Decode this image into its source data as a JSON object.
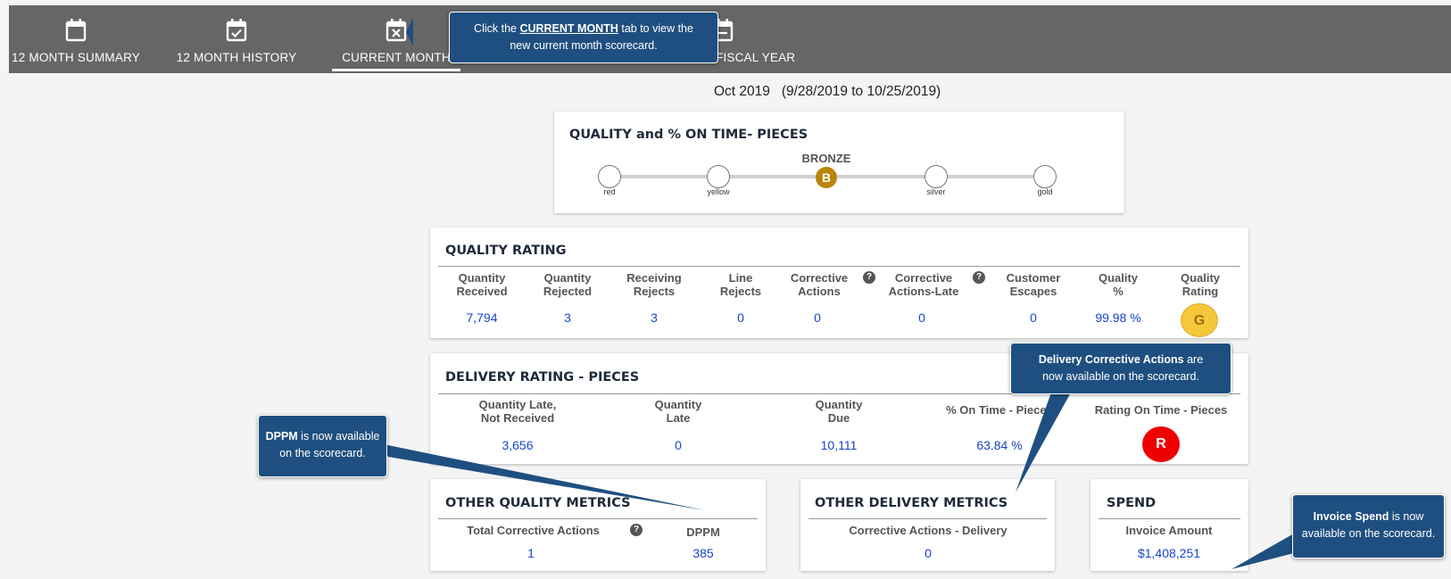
{
  "tabs": [
    {
      "label": "12 MONTH SUMMARY",
      "icon": "calendar-icon"
    },
    {
      "label": "12 MONTH HISTORY",
      "icon": "calendar-check-icon"
    },
    {
      "label": "CURRENT MONTH",
      "icon": "calendar-x-icon",
      "active": true
    },
    {
      "label": "FISCAL YEAR",
      "icon": "calendar-minus-icon"
    }
  ],
  "period": {
    "label": "Oct 2019",
    "range": "(9/28/2019 to 10/25/2019)"
  },
  "quality_time": {
    "title": "QUALITY and % ON TIME- PIECES",
    "current_level": "BRONZE",
    "current_letter": "B",
    "levels": [
      "red",
      "yellow",
      "silver",
      "gold"
    ]
  },
  "quality_rating": {
    "title": "QUALITY RATING",
    "headers": [
      [
        "Quantity",
        "Received"
      ],
      [
        "Quantity",
        "Rejected"
      ],
      [
        "Receiving",
        "Rejects"
      ],
      [
        "Line",
        "Rejects"
      ],
      [
        "Corrective",
        "Actions"
      ],
      [
        "Corrective",
        "Actions-Late"
      ],
      [
        "Customer",
        "Escapes"
      ],
      [
        "Quality",
        "%"
      ],
      [
        "Quality",
        "Rating"
      ]
    ],
    "values": [
      "7,794",
      "3",
      "3",
      "0",
      "0",
      "0",
      "0",
      "99.98 %"
    ],
    "rating_letter": "G",
    "rating_color": "#f6c73a"
  },
  "delivery_rating": {
    "title": "DELIVERY RATING - PIECES",
    "headers": [
      [
        "Quantity Late,",
        "Not Received"
      ],
      [
        "Quantity",
        "Late"
      ],
      [
        "Quantity",
        "Due"
      ],
      [
        "% On Time - Pieces"
      ],
      [
        "Rating On Time - Pieces"
      ]
    ],
    "values": [
      "3,656",
      "0",
      "10,111",
      "63.84 %"
    ],
    "rating_letter": "R",
    "rating_color": "#ee0000"
  },
  "other_quality": {
    "title": "OTHER QUALITY METRICS",
    "headers": [
      "Total Corrective Actions",
      "DPPM"
    ],
    "values": [
      "1",
      "385"
    ]
  },
  "other_delivery": {
    "title": "OTHER DELIVERY METRICS",
    "headers": [
      "Corrective Actions - Delivery"
    ],
    "values": [
      "0"
    ]
  },
  "spend": {
    "title": "SPEND",
    "headers": [
      "Invoice Amount"
    ],
    "values": [
      "$1,408,251"
    ]
  },
  "callouts": {
    "current_month": {
      "pre": "Click the ",
      "strong": "CURRENT MONTH",
      "post": " tab to view the",
      "line2": "new current month scorecard."
    },
    "dppm": {
      "strong": "DPPM",
      "post": " is now available",
      "line2": "on the scorecard."
    },
    "delivery_ca": {
      "strong": "Delivery Corrective Actions",
      "post": " are",
      "line2": "now available on the scorecard."
    },
    "invoice": {
      "strong": "Invoice Spend",
      "post": " is now",
      "line2": "available on the scorecard."
    }
  },
  "colors": {
    "topbar": "#666666",
    "accent_blue": "#1a44cc",
    "callout_bg": "#1f4f80",
    "bronze": "#b8860b"
  }
}
